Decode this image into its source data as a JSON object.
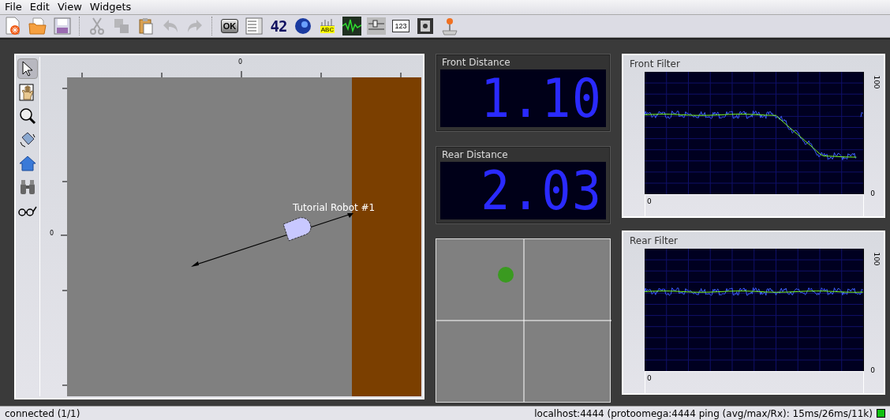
{
  "menu": [
    "File",
    "Edit",
    "View",
    "Widgets"
  ],
  "toolbar": [
    {
      "kind": "new",
      "disabled": false
    },
    {
      "kind": "open",
      "disabled": false
    },
    {
      "kind": "save",
      "disabled": false
    },
    {
      "kind": "sep"
    },
    {
      "kind": "cut",
      "disabled": true
    },
    {
      "kind": "copy",
      "disabled": true
    },
    {
      "kind": "paste",
      "disabled": false
    },
    {
      "kind": "undo",
      "disabled": true
    },
    {
      "kind": "redo",
      "disabled": true
    },
    {
      "kind": "sep"
    },
    {
      "kind": "text-button",
      "label": "OK",
      "disabled": false
    },
    {
      "kind": "list",
      "disabled": false
    },
    {
      "kind": "digits",
      "label": "42",
      "disabled": false
    },
    {
      "kind": "ball",
      "disabled": false
    },
    {
      "kind": "bars",
      "label": "ABC",
      "disabled": false
    },
    {
      "kind": "scope",
      "disabled": false
    },
    {
      "kind": "slider",
      "disabled": false
    },
    {
      "kind": "spin",
      "label": "123",
      "disabled": false
    },
    {
      "kind": "film",
      "disabled": false
    },
    {
      "kind": "joystick",
      "disabled": false
    }
  ],
  "map": {
    "tools": [
      {
        "kind": "pointer",
        "selected": true
      },
      {
        "kind": "hand",
        "selected": false
      },
      {
        "kind": "zoom",
        "selected": false
      },
      {
        "kind": "rotate",
        "selected": false
      },
      {
        "kind": "home",
        "selected": false
      },
      {
        "kind": "binoculars",
        "selected": false
      },
      {
        "kind": "glasses",
        "selected": false
      }
    ],
    "ruler_top_label": "0",
    "ruler_left_label": "0",
    "robot_label": "Tutorial Robot #1"
  },
  "displays": [
    {
      "title": "Front Distance",
      "value": "1.10"
    },
    {
      "title": "Rear Distance",
      "value": "2.03"
    }
  ],
  "plots": [
    {
      "title": "Front Filter",
      "y_top_label": "100",
      "y_bottom_label": "0",
      "x_label": "0"
    },
    {
      "title": "Rear Filter",
      "y_top_label": "100",
      "y_bottom_label": "0",
      "x_label": "0"
    }
  ],
  "status_bar": {
    "left": "connected (1/1)",
    "right": "localhost:4444 (protoomega:4444 ping (avg/max/Rx): 15ms/26ms/11k)",
    "connected": true
  }
}
